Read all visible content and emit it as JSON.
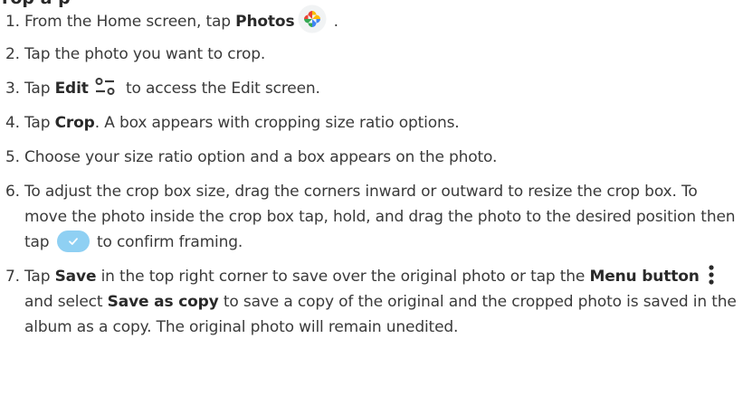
{
  "heading_fragment": "rop a p",
  "steps": [
    {
      "num": "1.",
      "pre": "From the Home screen, tap ",
      "bold": "Photos",
      "post": " ."
    },
    {
      "num": "2.",
      "text": "Tap the photo you want to crop."
    },
    {
      "num": "3.",
      "pre": "Tap ",
      "bold": "Edit",
      "post": " to access the Edit screen."
    },
    {
      "num": "4.",
      "pre": "Tap ",
      "bold": "Crop",
      "post": ". A box appears with cropping size ratio options."
    },
    {
      "num": "5.",
      "text": "Choose your size ratio option and a box appears on the photo."
    },
    {
      "num": "6.",
      "pre": "To adjust the crop box size, drag the corners inward or outward to resize the crop box. To move the photo inside the crop box tap, hold, and drag the photo to the desired position then tap ",
      "post": " to confirm framing."
    },
    {
      "num": "7.",
      "pre": "Tap ",
      "bold1": "Save",
      "mid1": " in the top right corner to save over the original photo or tap the ",
      "bold2": "Menu button",
      "mid2": " and select ",
      "bold3": "Save as copy",
      "post": " to save a copy of the original and the cropped photo is saved in the album as a copy. The original photo will remain unedited."
    }
  ],
  "icons": {
    "photos": "google-photos-pinwheel-icon",
    "edit": "edit-sliders-icon",
    "confirm": "checkmark-confirm-icon",
    "menu": "vertical-dots-menu-icon"
  },
  "colors": {
    "text": "#3a3a3a",
    "confirm_button": "#8fd0f3",
    "photos_red": "#ea4335",
    "photos_yellow": "#fbbc04",
    "photos_green": "#34a853",
    "photos_blue": "#4285f4"
  }
}
